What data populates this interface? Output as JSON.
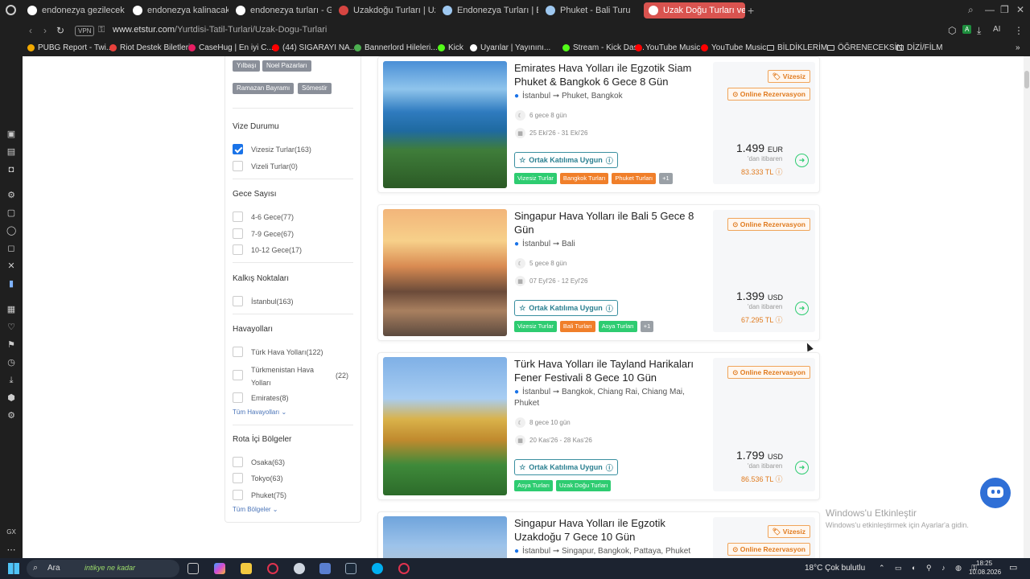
{
  "browser": {
    "tabs": [
      {
        "title": "endonezya gezilecek yerle",
        "favicon_color": "#ffffff"
      },
      {
        "title": "endonezya kalinacak yerle",
        "favicon_color": "#ffffff"
      },
      {
        "title": "endonezya turları - Google",
        "favicon_color": "#ffffff"
      },
      {
        "title": "Uzakdoğu Turları | Uzakdo",
        "favicon_color": "#d64541"
      },
      {
        "title": "Endonezya Turları | Endon",
        "favicon_color": "#9ec8f0"
      },
      {
        "title": "Phuket - Bali Turu",
        "favicon_color": "#9ec8f0"
      },
      {
        "title": "Uzak Doğu Turları ve Fiyatl",
        "favicon_color": "#ffffff"
      }
    ],
    "url_domain": "www.etstur.com",
    "url_path": "/Yurtdisi-Tatil-Turlari/Uzak-Dogu-Turlari",
    "vpn_label": "VPN",
    "bookmarks": [
      {
        "label": "PUBG Report - Twi...",
        "color": "#f2a900"
      },
      {
        "label": "Riot Destek Biletleri",
        "color": "#e8413c"
      },
      {
        "label": "CaseHug | En iyi C...",
        "color": "#e91e63"
      },
      {
        "label": "(44) SIGARAYI NA...",
        "color": "#ff0000"
      },
      {
        "label": "Bannerlord Hileleri...",
        "color": "#4caf50"
      },
      {
        "label": "Kick",
        "color": "#53fc18"
      },
      {
        "label": "Uyarılar | Yayınını...",
        "color": "#ffffff"
      },
      {
        "label": "Stream - Kick Das...",
        "color": "#53fc18"
      },
      {
        "label": "YouTube Music",
        "color": "#ff0000"
      },
      {
        "label": "YouTube Music",
        "color": "#ff0000"
      },
      {
        "label": "BİLDİKLERİM",
        "color": "#cccccc"
      },
      {
        "label": "ÖĞRENECEKSİN",
        "color": "#cccccc"
      },
      {
        "label": "DİZİ/FİLM",
        "color": "#cccccc"
      }
    ],
    "ai_label": "AI"
  },
  "filters": {
    "top_chips": [
      "Yılbaşı",
      "Noel Pazarları",
      "Ramazan Bayramı",
      "Sömestir"
    ],
    "visa": {
      "heading": "Vize Durumu",
      "options": [
        {
          "label": "Vizesiz Turlar(163)",
          "checked": true
        },
        {
          "label": "Vizeli Turlar(0)",
          "checked": false
        }
      ]
    },
    "nights": {
      "heading": "Gece Sayısı",
      "options": [
        {
          "label": "4-6 Gece(77)"
        },
        {
          "label": "7-9 Gece(67)"
        },
        {
          "label": "10-12 Gece(17)"
        }
      ]
    },
    "departure": {
      "heading": "Kalkış Noktaları",
      "options": [
        {
          "label": "İstanbul(163)"
        }
      ]
    },
    "airlines": {
      "heading": "Havayolları",
      "options": [
        {
          "label": "Türk Hava Yolları(122)"
        },
        {
          "label": "Türkmenistan Hava Yolları",
          "count": "(22)"
        },
        {
          "label": "Emirates(8)"
        }
      ],
      "more": "Tüm Havayolları"
    },
    "regions": {
      "heading": "Rota İçi Bölgeler",
      "options": [
        {
          "label": "Osaka(63)"
        },
        {
          "label": "Tokyo(63)"
        },
        {
          "label": "Phuket(75)"
        }
      ],
      "more": "Tüm Bölgeler"
    }
  },
  "tours": [
    {
      "title": "Emirates Hava Yolları ile Egzotik Siam Phuket & Bangkok 6 Gece 8 Gün",
      "route_from": "İstanbul",
      "route_to": "Phuket, Bangkok",
      "duration": "6 gece 8 gün",
      "dates": "25 Eki'26 - 31 Eki'26",
      "joint_label": "Ortak Katılıma Uygun",
      "tags": [
        {
          "label": "Vizesiz Turlar",
          "kind": "g"
        },
        {
          "label": "Bangkok Turları",
          "kind": "o"
        },
        {
          "label": "Phuket Turları",
          "kind": "o"
        },
        {
          "label": "+1",
          "kind": "x"
        }
      ],
      "badges": [
        "Vizesiz",
        "Online Rezervasyon"
      ],
      "price": "1.499",
      "currency": "EUR",
      "from_label": "'dan itibaren",
      "price_tl": "83.333 TL"
    },
    {
      "title": "Singapur Hava Yolları ile Bali 5 Gece 8 Gün",
      "route_from": "İstanbul",
      "route_to": "Bali",
      "duration": "5 gece 8 gün",
      "dates": "07 Eyl'26 - 12 Eyl'26",
      "joint_label": "Ortak Katılıma Uygun",
      "tags": [
        {
          "label": "Vizesiz Turlar",
          "kind": "g"
        },
        {
          "label": "Bali Turları",
          "kind": "o"
        },
        {
          "label": "Asya Turları",
          "kind": "g"
        },
        {
          "label": "+1",
          "kind": "x"
        }
      ],
      "badges": [
        "Online Rezervasyon"
      ],
      "price": "1.399",
      "currency": "USD",
      "from_label": "'dan itibaren",
      "price_tl": "67.295 TL"
    },
    {
      "title": "Türk Hava Yolları ile Tayland Harikaları Fener Festivali 8 Gece 10 Gün",
      "route_from": "İstanbul",
      "route_to": "Bangkok, Chiang Rai, Chiang Mai, Phuket",
      "duration": "8 gece 10 gün",
      "dates": "20 Kas'26 - 28 Kas'26",
      "joint_label": "Ortak Katılıma Uygun",
      "tags": [
        {
          "label": "Asya Turları",
          "kind": "g"
        },
        {
          "label": "Uzak Doğu Turları",
          "kind": "g"
        }
      ],
      "badges": [
        "Online Rezervasyon"
      ],
      "price": "1.799",
      "currency": "USD",
      "from_label": "'dan itibaren",
      "price_tl": "86.536 TL"
    },
    {
      "title": "Singapur Hava Yolları ile Egzotik Uzakdoğu 7 Gece 10 Gün",
      "route_from": "İstanbul",
      "route_to": "Singapur, Bangkok, Pattaya, Phuket",
      "badges": [
        "Vizesiz",
        "Online Rezervasyon"
      ]
    }
  ],
  "watermark": {
    "title": "Windows'u Etkinleştir",
    "subtitle": "Windows'u etkinleştirmek için Ayarlar'a gidin."
  },
  "taskbar": {
    "search_label": "Ara",
    "search_promo": "intikye ne kadar",
    "weather": "18°C  Çok bulutlu",
    "time": "18:25",
    "date": "10.08.2026"
  }
}
